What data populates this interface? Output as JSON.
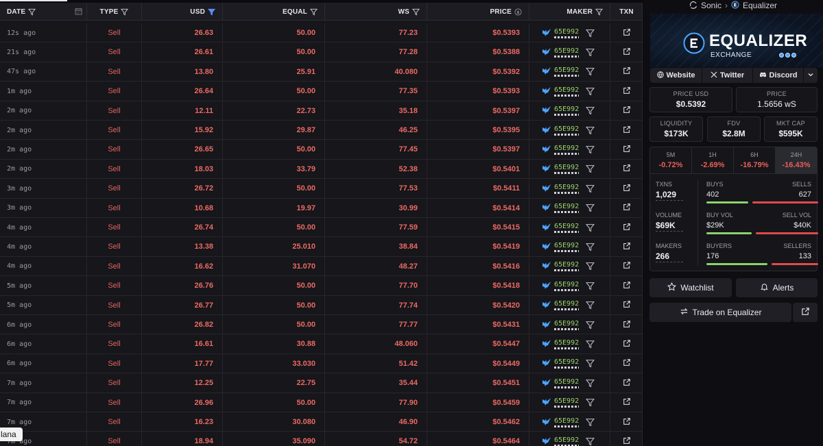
{
  "table": {
    "headers": {
      "date": "DATE",
      "type": "TYPE",
      "usd": "USD",
      "equal": "EQUAL",
      "ws": "WS",
      "price": "PRICE",
      "maker": "MAKER",
      "txn": "TXN"
    },
    "rows": [
      {
        "date": "12s ago",
        "type": "Sell",
        "usd": "26.63",
        "equal": "50.00",
        "ws": "77.23",
        "price": "$0.5393",
        "maker": "65E992"
      },
      {
        "date": "21s ago",
        "type": "Sell",
        "usd": "26.61",
        "equal": "50.00",
        "ws": "77.28",
        "price": "$0.5388",
        "maker": "65E992"
      },
      {
        "date": "47s ago",
        "type": "Sell",
        "usd": "13.80",
        "equal": "25.91",
        "ws": "40.080",
        "price": "$0.5392",
        "maker": "65E992"
      },
      {
        "date": "1m ago",
        "type": "Sell",
        "usd": "26.64",
        "equal": "50.00",
        "ws": "77.35",
        "price": "$0.5393",
        "maker": "65E992"
      },
      {
        "date": "2m ago",
        "type": "Sell",
        "usd": "12.11",
        "equal": "22.73",
        "ws": "35.18",
        "price": "$0.5397",
        "maker": "65E992"
      },
      {
        "date": "2m ago",
        "type": "Sell",
        "usd": "15.92",
        "equal": "29.87",
        "ws": "46.25",
        "price": "$0.5395",
        "maker": "65E992"
      },
      {
        "date": "2m ago",
        "type": "Sell",
        "usd": "26.65",
        "equal": "50.00",
        "ws": "77.45",
        "price": "$0.5397",
        "maker": "65E992"
      },
      {
        "date": "2m ago",
        "type": "Sell",
        "usd": "18.03",
        "equal": "33.79",
        "ws": "52.38",
        "price": "$0.5401",
        "maker": "65E992"
      },
      {
        "date": "3m ago",
        "type": "Sell",
        "usd": "26.72",
        "equal": "50.00",
        "ws": "77.53",
        "price": "$0.5411",
        "maker": "65E992"
      },
      {
        "date": "3m ago",
        "type": "Sell",
        "usd": "10.68",
        "equal": "19.97",
        "ws": "30.99",
        "price": "$0.5414",
        "maker": "65E992"
      },
      {
        "date": "4m ago",
        "type": "Sell",
        "usd": "26.74",
        "equal": "50.00",
        "ws": "77.59",
        "price": "$0.5415",
        "maker": "65E992"
      },
      {
        "date": "4m ago",
        "type": "Sell",
        "usd": "13.38",
        "equal": "25.010",
        "ws": "38.84",
        "price": "$0.5419",
        "maker": "65E992"
      },
      {
        "date": "4m ago",
        "type": "Sell",
        "usd": "16.62",
        "equal": "31.070",
        "ws": "48.27",
        "price": "$0.5416",
        "maker": "65E992"
      },
      {
        "date": "5m ago",
        "type": "Sell",
        "usd": "26.76",
        "equal": "50.00",
        "ws": "77.70",
        "price": "$0.5418",
        "maker": "65E992"
      },
      {
        "date": "5m ago",
        "type": "Sell",
        "usd": "26.77",
        "equal": "50.00",
        "ws": "77.74",
        "price": "$0.5420",
        "maker": "65E992"
      },
      {
        "date": "6m ago",
        "type": "Sell",
        "usd": "26.82",
        "equal": "50.00",
        "ws": "77.77",
        "price": "$0.5431",
        "maker": "65E992"
      },
      {
        "date": "6m ago",
        "type": "Sell",
        "usd": "16.61",
        "equal": "30.88",
        "ws": "48.060",
        "price": "$0.5447",
        "maker": "65E992"
      },
      {
        "date": "6m ago",
        "type": "Sell",
        "usd": "17.77",
        "equal": "33.030",
        "ws": "51.42",
        "price": "$0.5449",
        "maker": "65E992"
      },
      {
        "date": "7m ago",
        "type": "Sell",
        "usd": "12.25",
        "equal": "22.75",
        "ws": "35.44",
        "price": "$0.5451",
        "maker": "65E992"
      },
      {
        "date": "7m ago",
        "type": "Sell",
        "usd": "26.96",
        "equal": "50.00",
        "ws": "77.90",
        "price": "$0.5459",
        "maker": "65E992"
      },
      {
        "date": "7m ago",
        "type": "Sell",
        "usd": "16.23",
        "equal": "30.080",
        "ws": "46.90",
        "price": "$0.5462",
        "maker": "65E992"
      },
      {
        "date": "7m ago",
        "type": "Sell",
        "usd": "18.94",
        "equal": "35.090",
        "ws": "54.72",
        "price": "$0.5464",
        "maker": "65E992"
      }
    ]
  },
  "sidebar": {
    "breadcrumb": {
      "chain": "Sonic",
      "dex": "Equalizer"
    },
    "banner": {
      "title": "EQUALIZER",
      "subtitle": "EXCHANGE"
    },
    "links": {
      "website": "Website",
      "twitter": "Twitter",
      "discord": "Discord"
    },
    "stats": {
      "price_usd_label": "PRICE USD",
      "price_usd": "$0.5392",
      "price_label": "PRICE",
      "price": "1.5656 wS",
      "liquidity_label": "LIQUIDITY",
      "liquidity": "$173K",
      "fdv_label": "FDV",
      "fdv": "$2.8M",
      "mktcap_label": "MKT CAP",
      "mktcap": "$595K"
    },
    "periods": [
      {
        "label": "5M",
        "value": "-0.72%"
      },
      {
        "label": "1H",
        "value": "-2.69%"
      },
      {
        "label": "6H",
        "value": "-16.79%"
      },
      {
        "label": "24H",
        "value": "-16.43%"
      }
    ],
    "activity": {
      "txns_label": "TXNS",
      "txns": "1,029",
      "buys_label": "BUYS",
      "buys": "402",
      "sells_label": "SELLS",
      "sells": "627",
      "volume_label": "VOLUME",
      "volume": "$69K",
      "buyvol_label": "BUY VOL",
      "buyvol": "$29K",
      "sellvol_label": "SELL VOL",
      "sellvol": "$40K",
      "makers_label": "MAKERS",
      "makers": "266",
      "buyers_label": "BUYERS",
      "buyers": "176",
      "sellers_label": "SELLERS",
      "sellers": "133",
      "buy_ratio": 0.39,
      "buyvol_ratio": 0.42,
      "buyers_ratio": 0.57
    },
    "actions": {
      "watchlist": "Watchlist",
      "alerts": "Alerts",
      "trade": "Trade on Equalizer"
    }
  },
  "footer_tag": "lana",
  "colors": {
    "sell": "#ec6a62",
    "maker": "#9bd46a",
    "buy_bar": "#8bd46a",
    "sell_bar": "#e24a4a"
  }
}
